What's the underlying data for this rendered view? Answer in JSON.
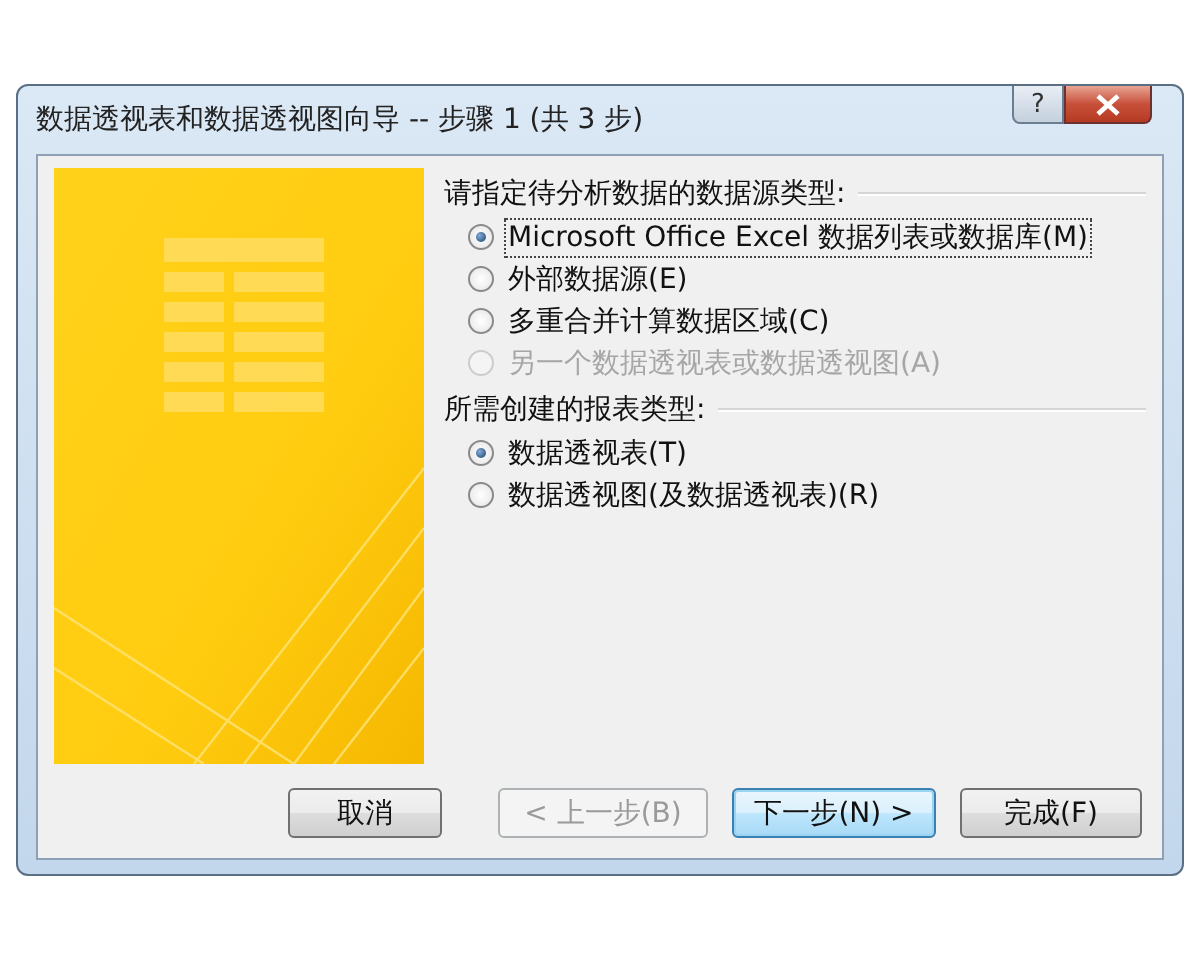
{
  "window": {
    "title": "数据透视表和数据透视图向导 -- 步骤 1 (共 3 步)",
    "help_button": "?"
  },
  "sections": [
    {
      "heading": "请指定待分析数据的数据源类型:",
      "options": [
        {
          "label": "Microsoft Office Excel 数据列表或数据库(M)",
          "selected": true,
          "disabled": false,
          "focused": true
        },
        {
          "label": "外部数据源(E)",
          "selected": false,
          "disabled": false,
          "focused": false
        },
        {
          "label": "多重合并计算数据区域(C)",
          "selected": false,
          "disabled": false,
          "focused": false
        },
        {
          "label": "另一个数据透视表或数据透视图(A)",
          "selected": false,
          "disabled": true,
          "focused": false
        }
      ]
    },
    {
      "heading": "所需创建的报表类型:",
      "options": [
        {
          "label": "数据透视表(T)",
          "selected": true,
          "disabled": false,
          "focused": false
        },
        {
          "label": "数据透视图(及数据透视表)(R)",
          "selected": false,
          "disabled": false,
          "focused": false
        }
      ]
    }
  ],
  "buttons": [
    {
      "label": "取消",
      "disabled": false,
      "default": false
    },
    {
      "label": "< 上一步(B)",
      "disabled": true,
      "default": false
    },
    {
      "label": "下一步(N) >",
      "disabled": false,
      "default": true
    },
    {
      "label": "完成(F)",
      "disabled": false,
      "default": false
    }
  ]
}
